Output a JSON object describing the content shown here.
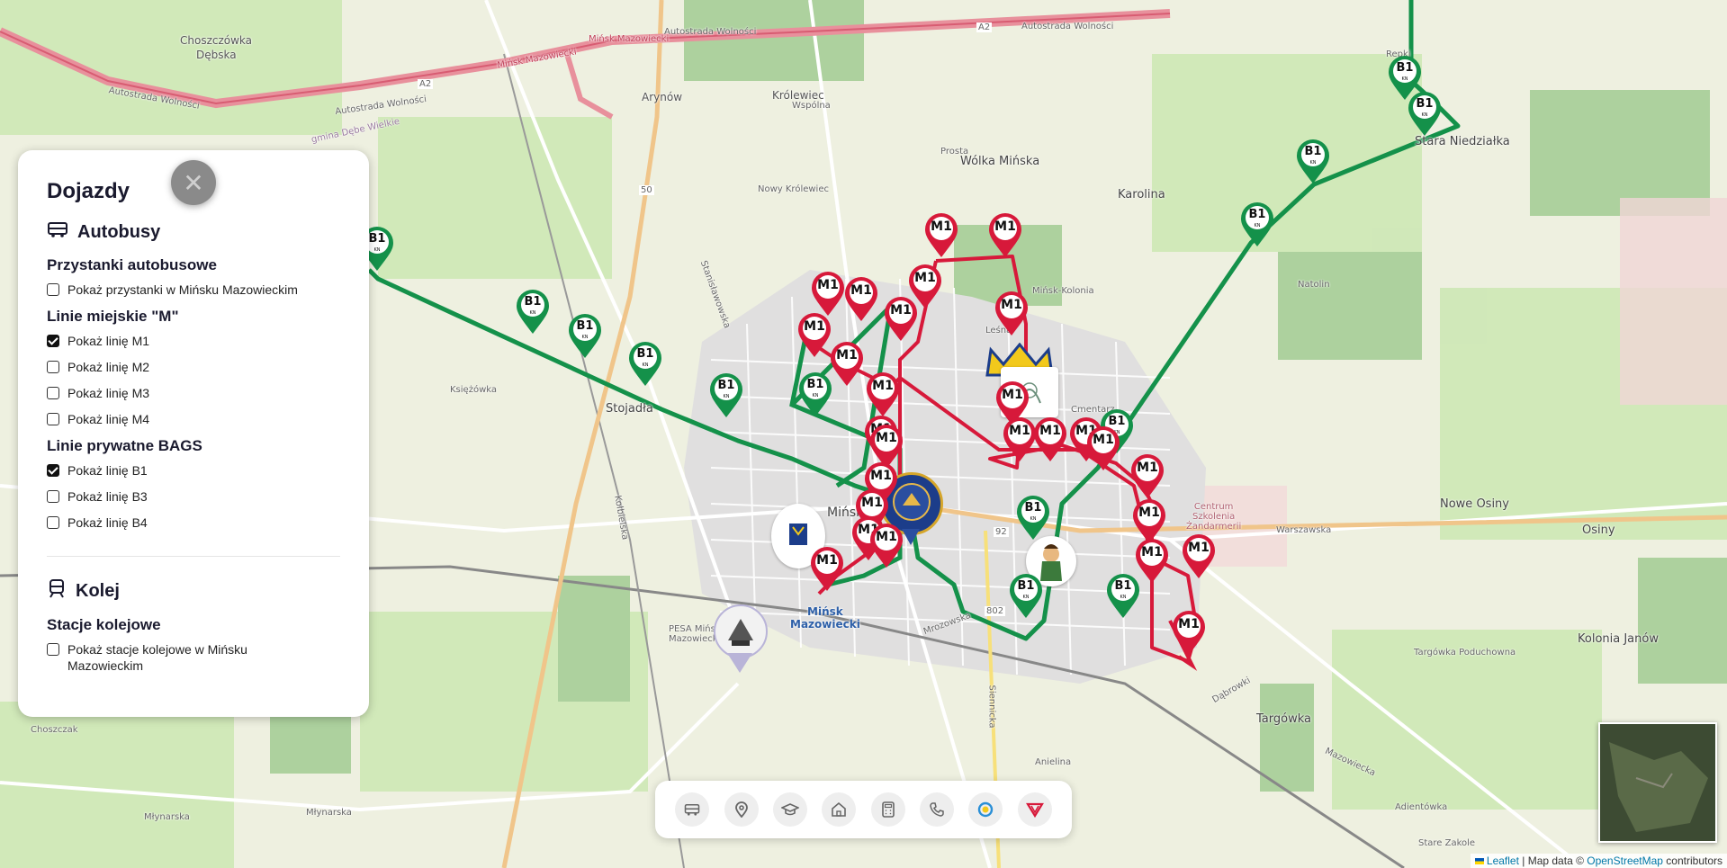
{
  "panel": {
    "title": "Dojazdy",
    "buses": {
      "heading": "Autobusy",
      "stops_heading": "Przystanki autobusowe",
      "stops_option": "Pokaż przystanki w Mińsku Mazowieckim",
      "city_lines_heading": "Linie miejskie \"M\"",
      "city_lines": [
        {
          "label": "Pokaż linię M1",
          "checked": true
        },
        {
          "label": "Pokaż linię M2",
          "checked": false
        },
        {
          "label": "Pokaż linię M3",
          "checked": false
        },
        {
          "label": "Pokaż linię M4",
          "checked": false
        }
      ],
      "private_lines_heading": "Linie prywatne BAGS",
      "private_lines": [
        {
          "label": "Pokaż linię B1",
          "checked": true
        },
        {
          "label": "Pokaż linię B3",
          "checked": false
        },
        {
          "label": "Pokaż linię B4",
          "checked": false
        }
      ]
    },
    "rail": {
      "heading": "Kolej",
      "stations_heading": "Stacje kolejowe",
      "stations_option": "Pokaż stacje kolejowe w Mińsku Mazowieckim"
    }
  },
  "toolbar": {
    "icons": [
      "bus-icon",
      "map-pin-icon",
      "graduation-cap-icon",
      "home-icon",
      "calculator-icon",
      "phone-icon",
      "circle-logo-icon",
      "v-logo-icon"
    ]
  },
  "map": {
    "labels": {
      "choszczowka": "Choszczówka",
      "debska": "Dębska",
      "arynow": "Arynów",
      "krolewiec": "Królewiec",
      "wspolna": "Wspólna",
      "nowy_krolewiec": "Nowy Królewiec",
      "prosta": "Prosta",
      "wolka": "Wólka Mińska",
      "karolina": "Karolina",
      "stara_niedzialka": "Stara Niedziałka",
      "repki": "Repki",
      "natolin": "Natolin",
      "stojadla": "Stojadła",
      "ksiezowka": "Księżówka",
      "minsk": "Mińsk Mazowiecki",
      "minsk_station": "Mińsk\nMazowiecki",
      "pesa": "PESA Mińsk\nMazowiecki",
      "nowe_osiny": "Nowe Osiny",
      "osiny": "Osiny",
      "warszawska": "Warszawska",
      "centrum": "Centrum\nSzkolenia\nŻandarmerii",
      "kolonia_janow": "Kolonia Janów",
      "targowka_pod": "Targówka Poduchowna",
      "targowka": "Targówka",
      "anielina": "Anielina",
      "adientowka": "Adientówka",
      "stare_zakole": "Stare Zakole",
      "choszczak": "Choszczak",
      "mlynarska": "Młynarska",
      "mlynarska2": "Młynarska",
      "autostrada1": "Autostrada Wolności",
      "autostrada2": "Autostrada Wolności",
      "autostrada3": "Autostrada Wolności",
      "autostrada4": "Autostrada Wolności",
      "a2_1": "A2",
      "a2_2": "A2",
      "minsk_maz_road": "Mińsk Mazowiecki",
      "minsk_maz_road2": "Mińsk Mazowiecki",
      "road50": "50",
      "road92": "92",
      "road802": "802",
      "lesna": "Leśna",
      "mrozowska": "Mrozowska",
      "siennicka": "Siennicka",
      "dabrowki": "Dąbrowki",
      "mazowiecka": "Mazowiecka",
      "gmina": "gmina Dębe Wielkie",
      "cmentarz": "Cmentarz",
      "kolonia": "Mińsk-Kolonia",
      "kolbielska": "Kołbielska",
      "stanislawowska": "Stanisławowska"
    },
    "markers": {
      "m1": "M1",
      "b1": "B1",
      "kn": "KN"
    },
    "attribution": {
      "leaflet": "Leaflet",
      "text": " | Map data © ",
      "osm": "OpenStreetMap",
      "contrib": " contributors"
    }
  },
  "colors": {
    "m1_line": "#d7193a",
    "b1_line": "#14914a",
    "panel_bg": "#ffffff"
  }
}
